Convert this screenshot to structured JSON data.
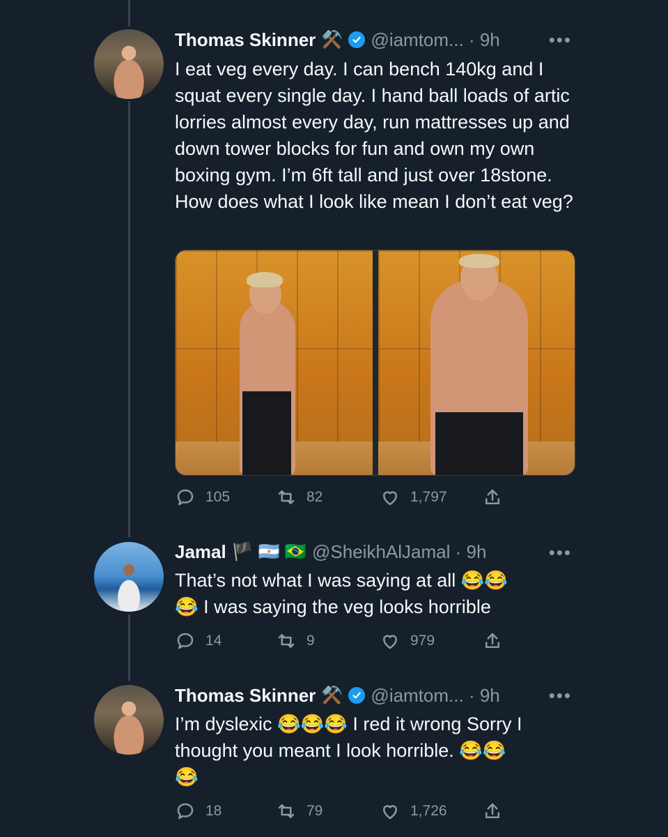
{
  "tweets": [
    {
      "name": "Thomas Skinner",
      "name_emoji": "⚒️",
      "verified": true,
      "handle": "@iamtom... · 9h",
      "text": "I eat veg every day. I can bench 140kg and I squat every single day. I hand ball loads of artic lorries almost every day, run mattresses up and down tower blocks for fun and own my own boxing gym. I’m 6ft tall and just over 18stone. How does what I look like mean I don’t eat veg?",
      "counts": {
        "reply": "105",
        "retweet": "82",
        "like": "1,797"
      }
    },
    {
      "name": "Jamal",
      "name_emoji": "🏴 🇦🇷 🇧🇷",
      "verified": false,
      "handle": "@SheikhAlJamal · 9h",
      "text": "That’s not what I was saying at all 😂😂\n😂 I was saying the veg looks horrible",
      "counts": {
        "reply": "14",
        "retweet": "9",
        "like": "979"
      }
    },
    {
      "name": "Thomas Skinner",
      "name_emoji": "⚒️",
      "verified": true,
      "handle": "@iamtom... · 9h",
      "text": "I’m dyslexic 😂😂😂 I red it wrong Sorry I thought you meant I look horrible. 😂😂\n😂",
      "counts": {
        "reply": "18",
        "retweet": "79",
        "like": "1,726"
      }
    }
  ],
  "more_label": "•••",
  "colors": {
    "background": "#15202b",
    "text": "#f7f9f9",
    "muted": "#8b98a5",
    "verified": "#1d9bf0",
    "line": "#38444d"
  },
  "icons": [
    "reply-icon",
    "retweet-icon",
    "like-icon",
    "share-icon",
    "verified-badge-icon"
  ]
}
